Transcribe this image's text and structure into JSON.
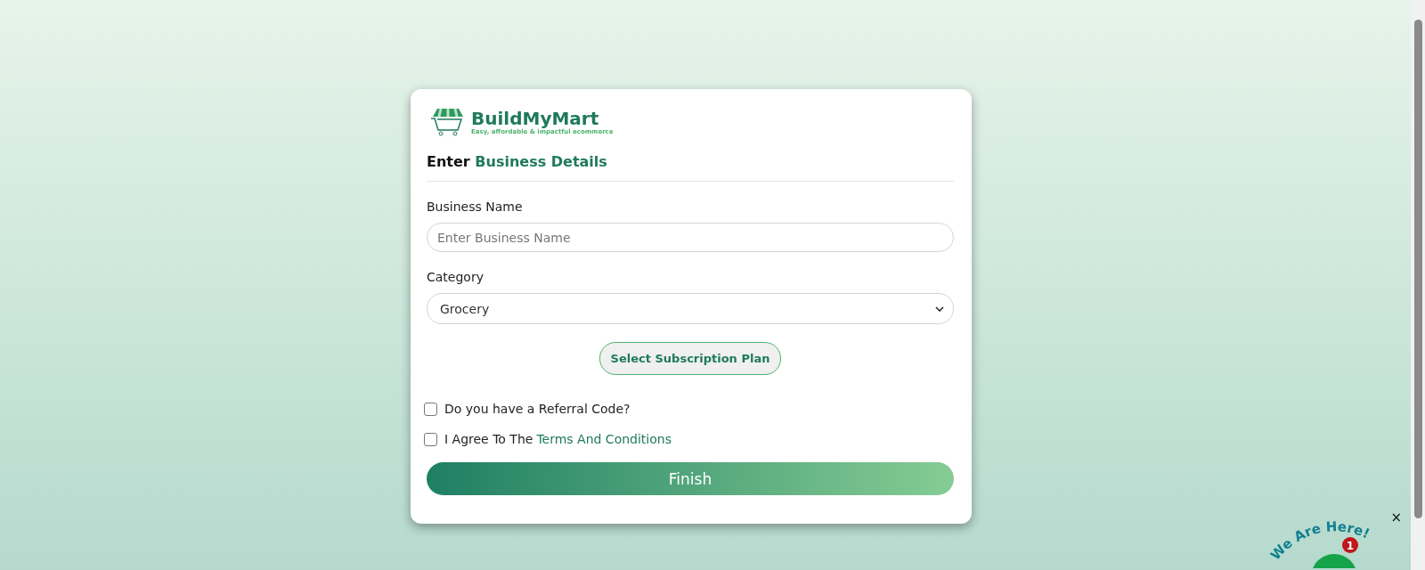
{
  "brand": {
    "name": "BuildMyMart",
    "tagline": "Easy, affordable & impactful ecommerce"
  },
  "heading": {
    "lead": "Enter",
    "accent": "Business Details"
  },
  "fields": [
    {
      "kind": "text",
      "label": "Business Name",
      "placeholder": "Enter Business Name"
    },
    {
      "kind": "select",
      "label": "Category",
      "value": "Grocery"
    }
  ],
  "plan_button": "Select Subscription Plan",
  "checks": [
    {
      "kind": "plain",
      "label": "Do you have a Referral Code?",
      "checked": false
    },
    {
      "kind": "terms",
      "label": "I Agree To The",
      "link": "Terms And Conditions",
      "checked": false
    }
  ],
  "submit": "Finish",
  "chat_widget": {
    "caption": "We Are Here!",
    "badge": "1",
    "close": "×"
  }
}
